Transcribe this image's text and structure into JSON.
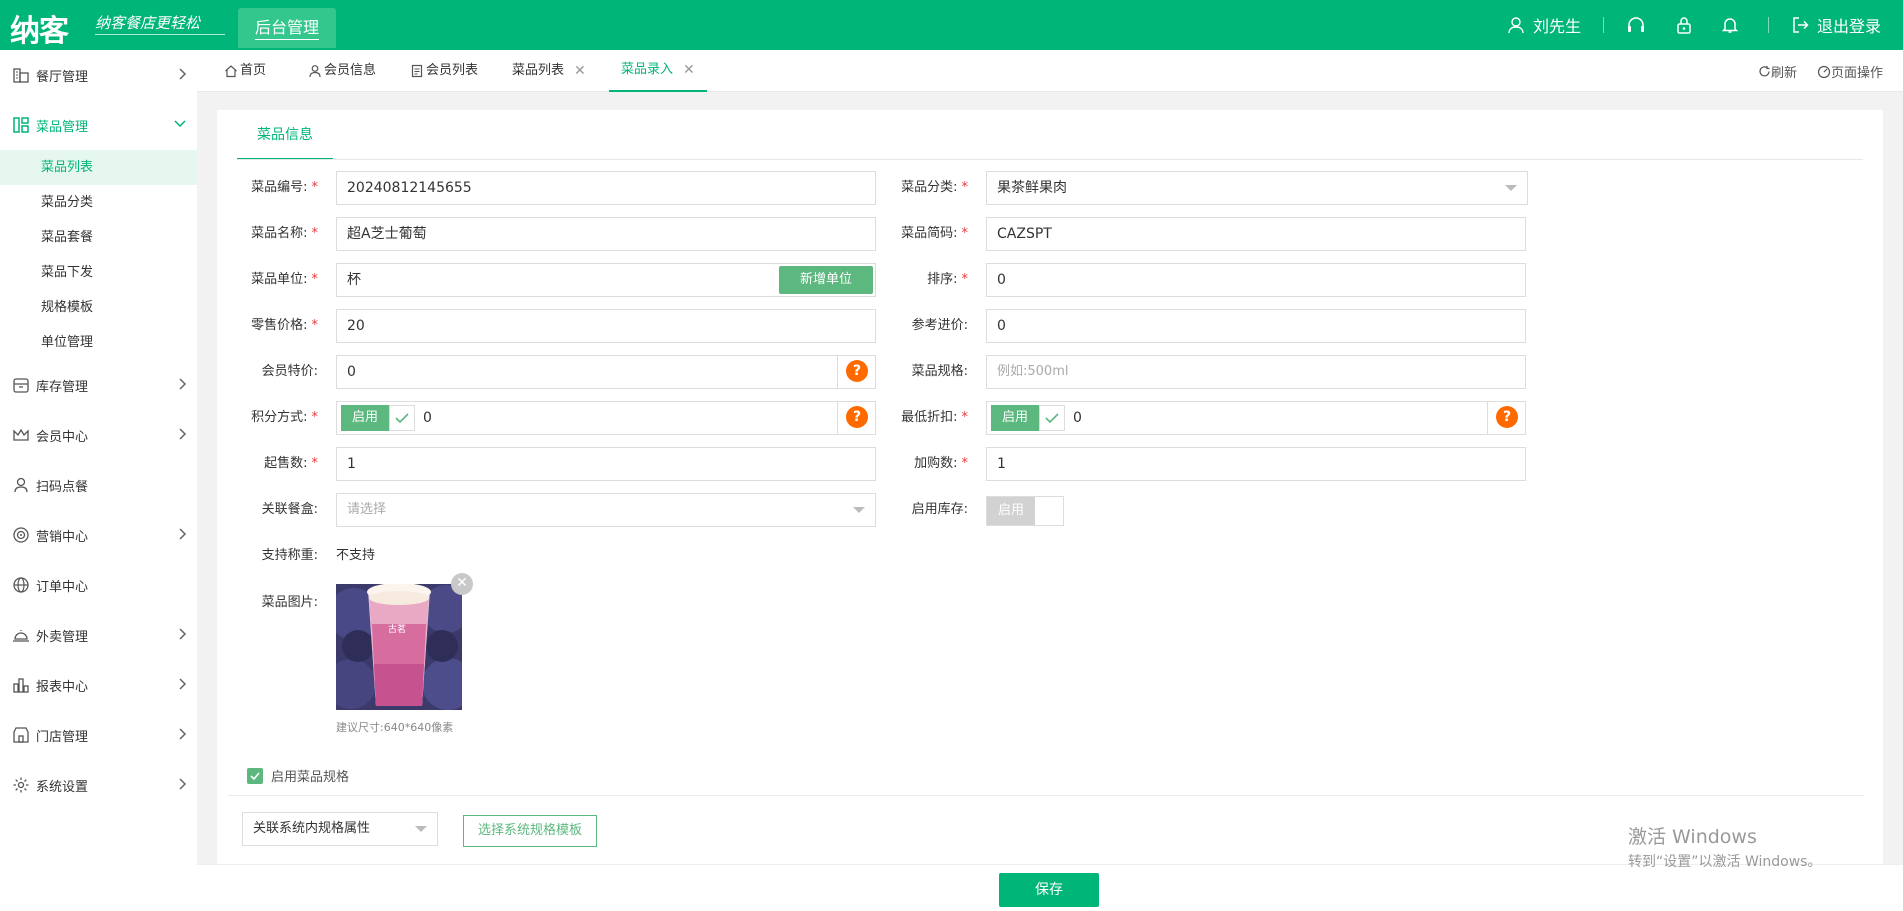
{
  "header": {
    "logo": "纳客",
    "slogan": "纳客餐店更轻松",
    "active_tab": "后台管理",
    "user_name": "刘先生",
    "logout_label": "退出登录"
  },
  "sidebar": {
    "items": [
      {
        "label": "餐厅管理",
        "icon": "restaurant-icon"
      },
      {
        "label": "菜品管理",
        "icon": "dish-icon"
      },
      {
        "label": "库存管理",
        "icon": "inventory-icon"
      },
      {
        "label": "会员中心",
        "icon": "crown-icon"
      },
      {
        "label": "扫码点餐",
        "icon": "user-icon"
      },
      {
        "label": "营销中心",
        "icon": "target-icon"
      },
      {
        "label": "订单中心",
        "icon": "globe-icon"
      },
      {
        "label": "外卖管理",
        "icon": "cloche-icon"
      },
      {
        "label": "报表中心",
        "icon": "bar-chart-icon"
      },
      {
        "label": "门店管理",
        "icon": "store-icon"
      },
      {
        "label": "系统设置",
        "icon": "gear-icon"
      }
    ],
    "dish_sub": [
      "菜品列表",
      "菜品分类",
      "菜品套餐",
      "菜品下发",
      "规格模板",
      "单位管理"
    ]
  },
  "tabs": [
    {
      "label": "首页"
    },
    {
      "label": "会员信息"
    },
    {
      "label": "会员列表"
    },
    {
      "label": "菜品列表",
      "close": "✕"
    },
    {
      "label": "菜品录入",
      "close": "✕"
    }
  ],
  "tab_actions": {
    "refresh": "刷新",
    "page_ops": "页面操作"
  },
  "form": {
    "section_tab": "菜品信息",
    "code_label": "菜品编号:",
    "code_value": "20240812145655",
    "category_label": "菜品分类:",
    "category_value": "果茶鲜果肉",
    "name_label": "菜品名称:",
    "name_value": "超A芝士葡萄",
    "short_label": "菜品简码:",
    "short_value": "CAZSPT",
    "unit_label": "菜品单位:",
    "unit_value": "杯",
    "add_unit": "新增单位",
    "sort_label": "排序:",
    "sort_value": "0",
    "price_label": "零售价格:",
    "price_value": "20",
    "ref_label": "参考进价:",
    "ref_value": "0",
    "member_label": "会员特价:",
    "member_value": "0",
    "spec_label": "菜品规格:",
    "spec_placeholder": "例如:500ml",
    "points_label": "积分方式:",
    "points_toggle": "启用",
    "points_value": "0",
    "discount_label": "最低折扣:",
    "discount_toggle": "启用",
    "discount_value": "0",
    "min_label": "起售数:",
    "min_value": "1",
    "add_label": "加购数:",
    "add_value": "1",
    "box_label": "关联餐盒:",
    "box_placeholder": "请选择",
    "stock_label": "启用库存:",
    "stock_toggle": "启用",
    "weigh_label": "支持称重:",
    "weigh_value": "不支持",
    "image_label": "菜品图片:",
    "image_hint": "建议尺寸:640*640像素",
    "cup_text": "古茗",
    "enable_spec": "启用菜品规格",
    "spec_select": "关联系统内规格属性",
    "choose_template": "选择系统规格模板",
    "help": "?",
    "required": "*",
    "close_x": "✕"
  },
  "save_label": "保存",
  "watermark": {
    "line1": "激活 Windows",
    "line2": "转到“设置”以激活 Windows。"
  },
  "colors": {
    "brand": "#00b578",
    "button": "#5cb87f",
    "help": "#ff6a00",
    "required": "#e4393c"
  }
}
